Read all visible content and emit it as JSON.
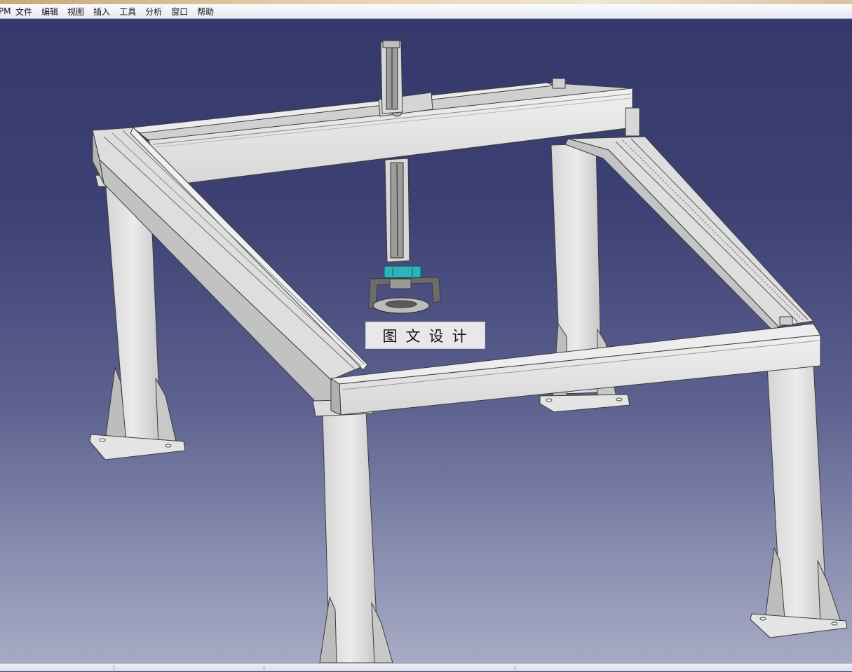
{
  "menubar": {
    "app_prefix": "PM",
    "items": [
      {
        "label": "文件"
      },
      {
        "label": "编辑"
      },
      {
        "label": "视图"
      },
      {
        "label": "插入"
      },
      {
        "label": "工具"
      },
      {
        "label": "分析"
      },
      {
        "label": "窗口"
      },
      {
        "label": "帮助"
      }
    ]
  },
  "viewport": {
    "watermark_text": "图文设计",
    "model": "gantry-frame-assembly"
  },
  "colors": {
    "background_top": "#34386a",
    "background_bottom": "#a7aac4",
    "metal_light": "#e6e6e6",
    "metal_mid": "#c8c8c8",
    "metal_dark": "#9a9a9a",
    "gripper_accent": "#2fb3b8"
  }
}
